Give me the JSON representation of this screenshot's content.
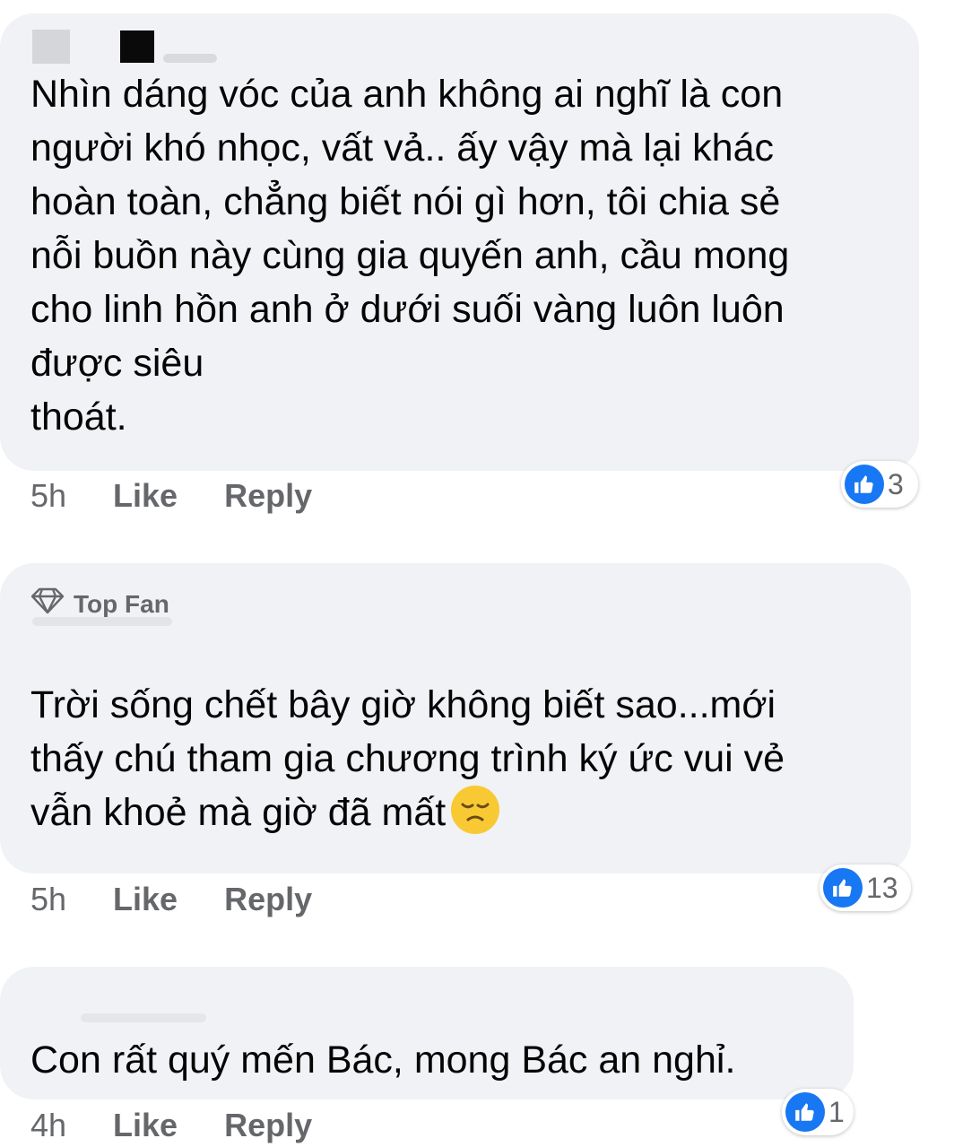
{
  "comments": [
    {
      "text": "Nhìn dáng vóc của anh không ai nghĩ là con\nngười khó nhọc, vất vả.. ấy vậy mà lại khác\nhoàn toàn, chẳng biết nói gì hơn, tôi chia sẻ\nnỗi buồn này cùng gia quyến anh, cầu mong\ncho linh hồn anh ở dưới suối vàng luôn luôn\nđược siêu\nthoát.",
      "time": "5h",
      "like_label": "Like",
      "reply_label": "Reply",
      "reaction_count": "3"
    },
    {
      "badge": "Top Fan",
      "text": "Trời sống chết bây giờ không biết sao...mới\nthấy chú tham gia chương trình ký ức vui vẻ\nvẫn khoẻ mà giờ đã mất",
      "time": "5h",
      "like_label": "Like",
      "reply_label": "Reply",
      "reaction_count": "13"
    },
    {
      "text": "Con rất quý mến Bác, mong Bác an nghỉ.",
      "time": "4h",
      "like_label": "Like",
      "reply_label": "Reply",
      "reaction_count": "1"
    }
  ],
  "icons": {
    "reaction": "thumbs-up-icon",
    "badge": "diamond-icon",
    "emoji": "disappointed-face-emoji"
  },
  "colors": {
    "bubble": "#f0f2f5",
    "like_blue": "#1877f2",
    "meta_text": "#65676b"
  }
}
